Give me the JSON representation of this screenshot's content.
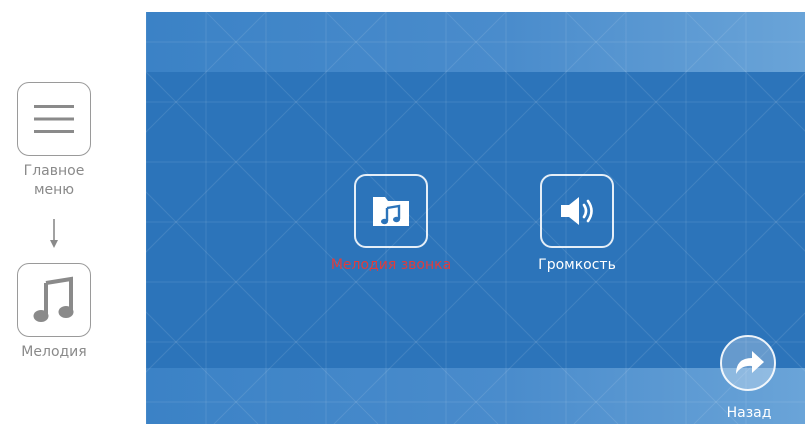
{
  "guide": {
    "step1_label": "Главное\nменю",
    "step1_icon": "menu-icon",
    "step2_label": "Мелодия",
    "step2_icon": "music-note-icon"
  },
  "screen": {
    "items": [
      {
        "label": "Мелодия звонка",
        "icon": "music-folder-icon",
        "selected": true,
        "label_color": "#e03c3c"
      },
      {
        "label": "Громкость",
        "icon": "speaker-icon",
        "selected": false,
        "label_color": "#ffffff"
      }
    ],
    "back_label": "Назад",
    "back_icon": "back-arrow-icon"
  },
  "colors": {
    "screen_bg": "#2c74ba",
    "band_bg": "#4a8ccc",
    "selected_text": "#e03c3c",
    "guide_gray": "#8a8a8a"
  }
}
